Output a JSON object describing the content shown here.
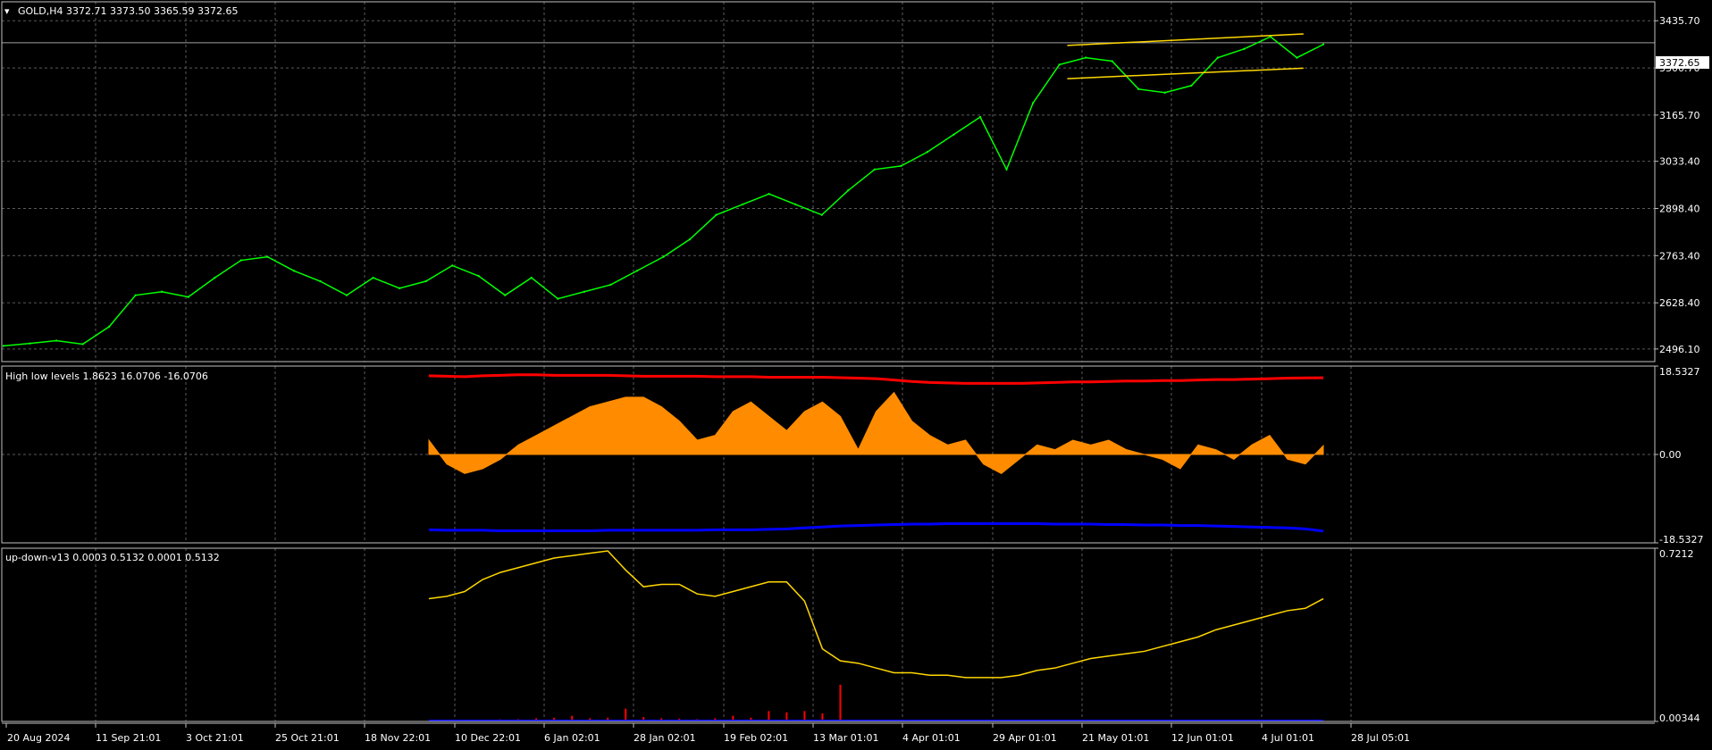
{
  "chart_data": [
    {
      "type": "line",
      "panel": "main",
      "title": "GOLD,H4  3372.71 3373.50 3365.59 3372.65",
      "symbol": "GOLD",
      "timeframe": "H4",
      "ohlc": {
        "open": 3372.71,
        "high": 3373.5,
        "low": 3365.59,
        "close": 3372.65
      },
      "current_price_label": "3372.65",
      "current_price": 3372.65,
      "ylim": [
        2460,
        3490
      ],
      "yticks": [
        "3435.70",
        "3300.70",
        "3165.70",
        "3033.40",
        "2898.40",
        "2763.40",
        "2628.40",
        "2496.10"
      ],
      "ytick_values": [
        3435.7,
        3300.7,
        3165.7,
        3033.4,
        2898.4,
        2763.4,
        2628.4,
        2496.1
      ],
      "grid": true,
      "colors": {
        "price": "#00ff00",
        "channel": "#ffd700",
        "background": "#000000",
        "grid": "#5a5a5a"
      },
      "x": [
        0,
        2,
        4,
        6,
        8,
        10,
        12,
        14,
        16,
        18,
        20,
        22,
        24,
        26,
        28,
        30,
        32,
        34,
        36,
        38,
        40,
        42,
        44,
        46,
        48,
        50,
        52,
        54,
        56,
        58,
        60,
        62,
        64,
        66,
        68,
        70,
        72,
        74,
        76,
        78,
        80,
        82,
        84,
        86,
        88,
        90,
        92,
        94,
        96,
        98,
        100
      ],
      "series": [
        {
          "values": [
            2505,
            2512,
            2520,
            2510,
            2560,
            2650,
            2660,
            2645,
            2700,
            2750,
            2760,
            2720,
            2690,
            2650,
            2700,
            2670,
            2690,
            2735,
            2705,
            2650,
            2700,
            2640,
            2660,
            2680,
            2720,
            2760,
            2810,
            2880,
            2910,
            2940,
            2910,
            2880,
            2950,
            3010,
            3020,
            3060,
            3110,
            3160,
            3010,
            3200,
            3310,
            3330,
            3320,
            3240,
            3230,
            3250,
            3330,
            3355,
            3390,
            3330,
            3368
          ]
        }
      ],
      "channel": {
        "x": [
          80.6,
          98.5
        ],
        "upper": [
          3365,
          3398
        ],
        "lower": [
          3270,
          3300
        ]
      }
    },
    {
      "type": "area",
      "panel": "indicator1",
      "title": "High low levels 1.8623 16.0706 -16.0706",
      "ylim": [
        -18.5327,
        18.5327
      ],
      "yticks": [
        "18.5327",
        "0.00",
        "-18.5327"
      ],
      "ytick_values": [
        18.5327,
        0,
        -18.5327
      ],
      "colors": {
        "hist": "#ff8c00",
        "upper": "#ff0000",
        "lower": "#0000ff"
      },
      "x": [
        0,
        2,
        4,
        6,
        8,
        10,
        12,
        14,
        16,
        18,
        20,
        22,
        24,
        26,
        28,
        30,
        32,
        34,
        36,
        38,
        40,
        42,
        44,
        46,
        48,
        50,
        52,
        54,
        56,
        58,
        60,
        62,
        64,
        66,
        68,
        70,
        72,
        74,
        76,
        78,
        80,
        82,
        84,
        86,
        88,
        90,
        92,
        94,
        96,
        98,
        100
      ],
      "series": [
        {
          "name": "hist",
          "values": [
            3,
            -2,
            -4,
            -3,
            -1,
            2,
            4,
            6,
            8,
            10,
            11,
            12,
            12,
            10,
            7,
            3,
            4,
            9,
            11,
            8,
            5,
            9,
            11,
            8,
            1,
            9,
            13,
            7,
            4,
            2,
            3,
            -2,
            -4,
            -1,
            2,
            1,
            3,
            2,
            3,
            1,
            0,
            -1,
            -3,
            2,
            1,
            -1,
            2,
            4,
            -1,
            -2,
            1.86
          ]
        },
        {
          "name": "upper",
          "values": [
            16.5,
            16.4,
            16.3,
            16.5,
            16.6,
            16.7,
            16.7,
            16.6,
            16.6,
            16.6,
            16.6,
            16.5,
            16.4,
            16.4,
            16.4,
            16.4,
            16.3,
            16.3,
            16.3,
            16.2,
            16.2,
            16.2,
            16.2,
            16.1,
            16.0,
            15.9,
            15.6,
            15.3,
            15.1,
            15.0,
            14.9,
            14.9,
            14.9,
            14.9,
            15.0,
            15.1,
            15.2,
            15.2,
            15.3,
            15.4,
            15.4,
            15.5,
            15.5,
            15.6,
            15.7,
            15.7,
            15.8,
            15.9,
            16.0,
            16.05,
            16.07
          ]
        },
        {
          "name": "lower",
          "values": [
            -15.8,
            -15.9,
            -15.9,
            -15.9,
            -16.0,
            -16.0,
            -16.0,
            -16.0,
            -16.0,
            -16.0,
            -15.9,
            -15.9,
            -15.9,
            -15.9,
            -15.9,
            -15.9,
            -15.8,
            -15.8,
            -15.8,
            -15.7,
            -15.6,
            -15.4,
            -15.2,
            -15.0,
            -14.9,
            -14.8,
            -14.7,
            -14.6,
            -14.6,
            -14.5,
            -14.5,
            -14.5,
            -14.5,
            -14.5,
            -14.5,
            -14.6,
            -14.6,
            -14.6,
            -14.7,
            -14.7,
            -14.8,
            -14.8,
            -14.9,
            -14.9,
            -15.0,
            -15.1,
            -15.2,
            -15.3,
            -15.4,
            -15.6,
            -16.07
          ]
        }
      ]
    },
    {
      "type": "line",
      "panel": "indicator2",
      "title": "up-down-v13 0.0003 0.5132 0.0001 0.5132",
      "ylim": [
        -0.00344,
        0.7212
      ],
      "yticks": [
        "0.7212",
        "0.00344"
      ],
      "ytick_values": [
        0.7212,
        -0.00344
      ],
      "colors": {
        "main": "#ffd700",
        "spike": "#ff0000",
        "base": "#0000ff"
      },
      "x": [
        0,
        2,
        4,
        6,
        8,
        10,
        12,
        14,
        16,
        18,
        20,
        22,
        24,
        26,
        28,
        30,
        32,
        34,
        36,
        38,
        40,
        42,
        44,
        46,
        48,
        50,
        52,
        54,
        56,
        58,
        60,
        62,
        64,
        66,
        68,
        70,
        72,
        74,
        76,
        78,
        80,
        82,
        84,
        86,
        88,
        90,
        92,
        94,
        96,
        98,
        100
      ],
      "series": [
        {
          "name": "main",
          "values": [
            0.51,
            0.52,
            0.54,
            0.59,
            0.62,
            0.64,
            0.66,
            0.68,
            0.69,
            0.7,
            0.71,
            0.63,
            0.56,
            0.57,
            0.57,
            0.53,
            0.52,
            0.54,
            0.56,
            0.58,
            0.58,
            0.5,
            0.3,
            0.25,
            0.24,
            0.22,
            0.2,
            0.2,
            0.19,
            0.19,
            0.18,
            0.18,
            0.18,
            0.19,
            0.21,
            0.22,
            0.24,
            0.26,
            0.27,
            0.28,
            0.29,
            0.31,
            0.33,
            0.35,
            0.38,
            0.4,
            0.42,
            0.44,
            0.46,
            0.47,
            0.51
          ]
        },
        {
          "name": "spike",
          "values": [
            0,
            0,
            0,
            0.002,
            0.005,
            0.006,
            0.01,
            0.012,
            0.02,
            0.01,
            0.012,
            0.05,
            0.015,
            0.01,
            0.008,
            0.006,
            0.01,
            0.02,
            0.012,
            0.04,
            0.035,
            0.04,
            0.03,
            0.15,
            0.004,
            0.003,
            0.003,
            0.002,
            0.002,
            0.001,
            0.001,
            0.001,
            0.001,
            0.001,
            0.001,
            0.001,
            0.001,
            0.001,
            0.001,
            0.001,
            0.001,
            0.001,
            0.001,
            0.001,
            0.001,
            0.001,
            0.001,
            0.001,
            0.001,
            0.001,
            0.0003
          ]
        },
        {
          "name": "base",
          "values": [
            0.0001,
            0.0001,
            0.0001,
            0.0001,
            0.0001,
            0.0001,
            0.0001,
            0.0001,
            0.0001,
            0.0001,
            0.0001,
            0.0001,
            0.0001,
            0.0001,
            0.0001,
            0.0001,
            0.0001,
            0.0001,
            0.0001,
            0.0001,
            0.0001,
            0.0001,
            0.0001,
            0.0001,
            0.0001,
            0.0001,
            0.0001,
            0.0001,
            0.0001,
            0.0001,
            0.0001,
            0.0001,
            0.0001,
            0.0001,
            0.0001,
            0.0001,
            0.0001,
            0.0001,
            0.0001,
            0.0001,
            0.0001,
            0.0001,
            0.0001,
            0.0001,
            0.0001,
            0.0001,
            0.0001,
            0.0001,
            0.0001,
            0.0001,
            0.0001
          ]
        }
      ]
    }
  ],
  "x_axis": {
    "labels": [
      "20 Aug 2024",
      "11 Sep 21:01",
      "3 Oct 21:01",
      "25 Oct 21:01",
      "18 Nov 22:01",
      "10 Dec 22:01",
      "6 Jan 02:01",
      "28 Jan 02:01",
      "19 Feb 02:01",
      "13 Mar 01:01",
      "4 Apr 01:01",
      "29 Apr 01:01",
      "21 May 01:01",
      "12 Jun 01:01",
      "4 Jul 01:01",
      "28 Jul 05:01"
    ]
  }
}
